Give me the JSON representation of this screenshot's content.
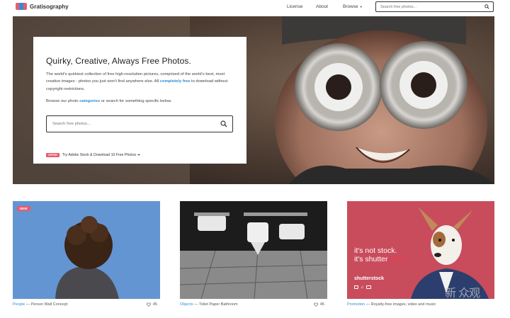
{
  "brand": {
    "name": "Gratisography",
    "logo_colors": [
      "#ec5a6b",
      "#2c8fd6",
      "#ec5a6b"
    ]
  },
  "nav": {
    "license": "License",
    "about": "About",
    "browse": "Browse",
    "search_placeholder": "Search free photos..."
  },
  "hero": {
    "title": "Quirky, Creative, Always Free Photos.",
    "desc_part1": "The world’s quirkiest collection of free high-resolution pictures, comprised of the world’s best, most creative images - photos you just won’t find anywhere else. All",
    "desc_link": "completely free",
    "desc_part2": "to download without copyright restrictions.",
    "browse_part1": "Browse our photo",
    "browse_link": "categories",
    "browse_part2": "or search for something specific below.",
    "search_placeholder": "Search free photos...",
    "offer_badge": "OFFER",
    "offer_text": "Try Adobe Stock & Download 10 Free Photos ➔"
  },
  "cards": [
    {
      "badge": "NEW",
      "category": "People",
      "title": " — Person Wall Concept",
      "likes": "45"
    },
    {
      "category": "Objects",
      "title": " — Toilet Paper Bathroom",
      "likes": "45"
    },
    {
      "category": "Promotion",
      "title": " — Royalty-free images, video and music",
      "promo_line1": "it's not stock.",
      "promo_line2_a": "it's shutter",
      "promo_line2_b": "stock",
      "promo_brand": "shutterstock"
    }
  ],
  "watermark": "新 众观",
  "colors": {
    "accent": "#2c8fd6",
    "badge": "#ec5a6b"
  }
}
